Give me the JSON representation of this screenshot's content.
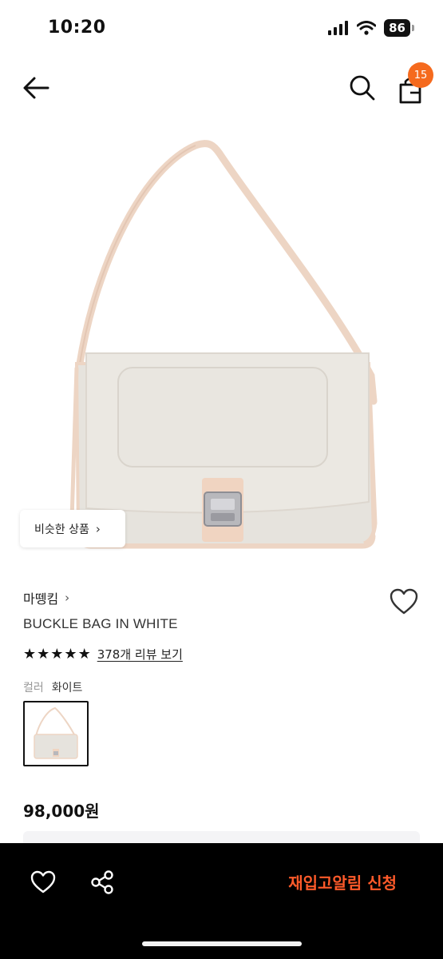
{
  "status_bar": {
    "time": "10:20",
    "battery": "86",
    "icons": [
      "signal-icon",
      "wifi-icon",
      "battery-icon"
    ]
  },
  "nav": {
    "icons": [
      "back-arrow-icon",
      "search-icon",
      "shopping-bag-icon"
    ],
    "cart_count": "15"
  },
  "image": {
    "similar_button": "비슷한 상품",
    "subject": "white shoulder bag with beige leather trim and metal buckle"
  },
  "product": {
    "brand": "마뗑킴",
    "name": "BUCKLE BAG IN WHITE",
    "rating_stars": 5,
    "review_link": "378개 리뷰 보기",
    "color_label": "컬러",
    "color_value": "화이트",
    "price": "98,000원"
  },
  "bottom_bar": {
    "cta": "재입고알림 신청",
    "icons": [
      "heart-outline-icon",
      "share-icon"
    ]
  },
  "colors": {
    "accent": "#f56a1e",
    "cta_text": "#ff5a2a",
    "bottom_bar_bg": "#000000",
    "bag_body": "#e8e4dc",
    "bag_trim": "#edd5c4"
  }
}
